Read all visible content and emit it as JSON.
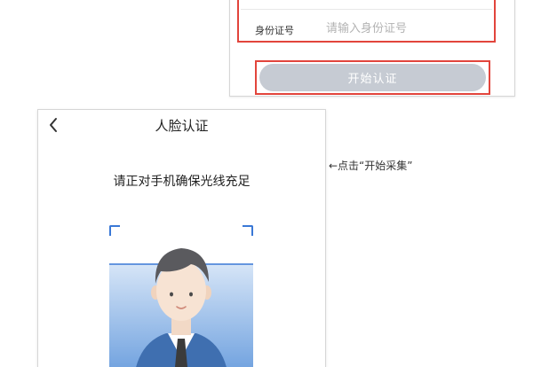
{
  "top_form": {
    "id_label": "身份证号",
    "id_placeholder": "请输入身份证号",
    "start_button_label": "开始认证"
  },
  "annotation": {
    "text": "←点击“开始采集”"
  },
  "face_screen": {
    "title": "人脸认证",
    "instruction": "请正对手机确保光线充足"
  },
  "colors": {
    "highlight_border": "#e2453c",
    "button_disabled": "#c6cbd3",
    "scan_frame": "#3a78d6",
    "scan_gradient_top": "#cfe0f5",
    "scan_gradient_bottom": "#6fa3e0"
  },
  "icons": {
    "back": "chevron-left-icon",
    "portrait": "face-portrait-illustration"
  }
}
